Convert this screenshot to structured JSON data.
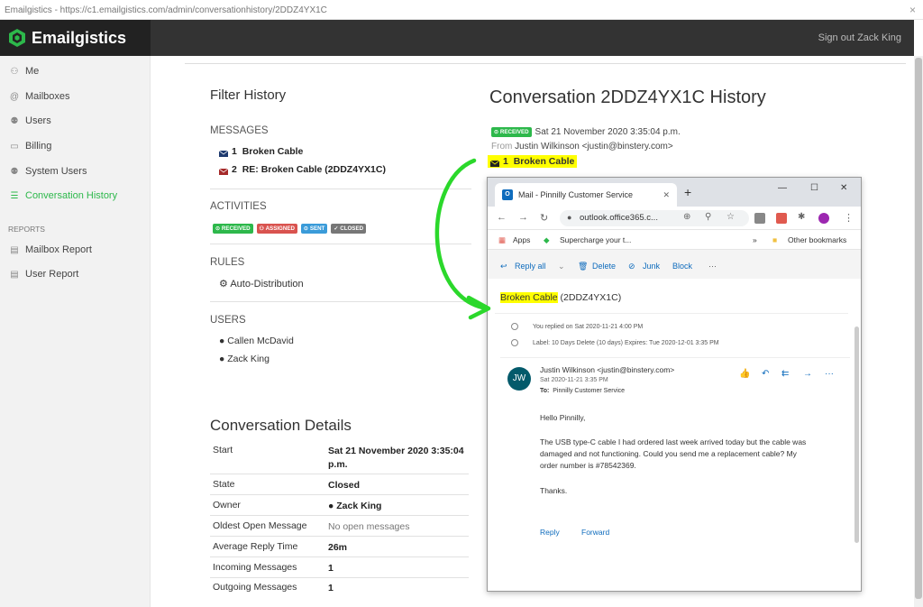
{
  "browser": {
    "title": "Emailgistics - https://c1.emailgistics.com/admin/conversationhistory/2DDZ4YX1C",
    "close": "×"
  },
  "header": {
    "brand": "Emailgistics",
    "signout": "Sign out Zack King"
  },
  "sidebar": {
    "items": [
      {
        "label": "Me",
        "icon": "user-icon"
      },
      {
        "label": "Mailboxes",
        "icon": "at-icon"
      },
      {
        "label": "Users",
        "icon": "users-icon"
      },
      {
        "label": "Billing",
        "icon": "card-icon"
      },
      {
        "label": "System Users",
        "icon": "system-users-icon"
      },
      {
        "label": "Conversation History",
        "icon": "list-icon"
      }
    ],
    "reports_label": "REPORTS",
    "reports": [
      {
        "label": "Mailbox Report",
        "icon": "file-icon"
      },
      {
        "label": "User Report",
        "icon": "file-icon"
      }
    ]
  },
  "filter": {
    "title": "Filter History",
    "messages_label": "MESSAGES",
    "messages": [
      {
        "num": "1",
        "subject": "Broken Cable",
        "color": "#1e3a6e"
      },
      {
        "num": "2",
        "subject": "RE: Broken Cable (2DDZ4YX1C)",
        "color": "#a52a2a"
      }
    ],
    "activities_label": "ACTIVITIES",
    "activities": [
      "RECEIVED",
      "ASSIGNED",
      "SENT",
      "CLOSED"
    ],
    "rules_label": "RULES",
    "rule": "Auto-Distribution",
    "users_label": "USERS",
    "users": [
      "Callen McDavid",
      "Zack King"
    ]
  },
  "details": {
    "title": "Conversation Details",
    "rows": [
      {
        "k": "Start",
        "v": "Sat 21 November 2020 3:35:04 p.m."
      },
      {
        "k": "State",
        "v": "Closed"
      },
      {
        "k": "Owner",
        "v": "Zack King"
      },
      {
        "k": "Oldest Open Message",
        "v": "No open messages"
      },
      {
        "k": "Average Reply Time",
        "v": "26m"
      },
      {
        "k": "Incoming Messages",
        "v": "1"
      },
      {
        "k": "Outgoing Messages",
        "v": "1"
      }
    ]
  },
  "history": {
    "title": "Conversation 2DDZ4YX1C History",
    "badge": "RECEIVED",
    "date": "Sat 21 November 2020 3:35:04 p.m.",
    "from_label": "From",
    "from": "Justin Wilkinson <justin@binstery.com>",
    "msg_num": "1",
    "msg_subject": "Broken Cable"
  },
  "popup": {
    "tab_title": "Mail - Pinnilly Customer Service",
    "url": "outlook.office365.c...",
    "bookmarks": {
      "apps": "Apps",
      "supercharge": "Supercharge your t...",
      "more": "»",
      "other": "Other bookmarks"
    },
    "toolbar": {
      "reply_all": "Reply all",
      "delete": "Delete",
      "junk": "Junk",
      "block": "Block",
      "more": "···"
    },
    "subject_hl": "Broken Cable",
    "subject_rest": "(2DDZ4YX1C)",
    "info1": "You replied on Sat 2020-11-21 4:00 PM",
    "info2": "Label: 10 Days Delete (10 days) Expires: Tue 2020-12-01 3:35 PM",
    "avatar": "JW",
    "from": "Justin Wilkinson <justin@binstery.com>",
    "date": "Sat 2020-11-21 3:35 PM",
    "to_label": "To:",
    "to": "Pinnilly Customer Service",
    "body1": "Hello Pinnilly,",
    "body2": "The USB type-C cable I had ordered last week arrived today but the cable was damaged and not functioning. Could you send me a replacement cable? My order number is #78542369.",
    "body3": "Thanks.",
    "reply": "Reply",
    "forward": "Forward"
  }
}
